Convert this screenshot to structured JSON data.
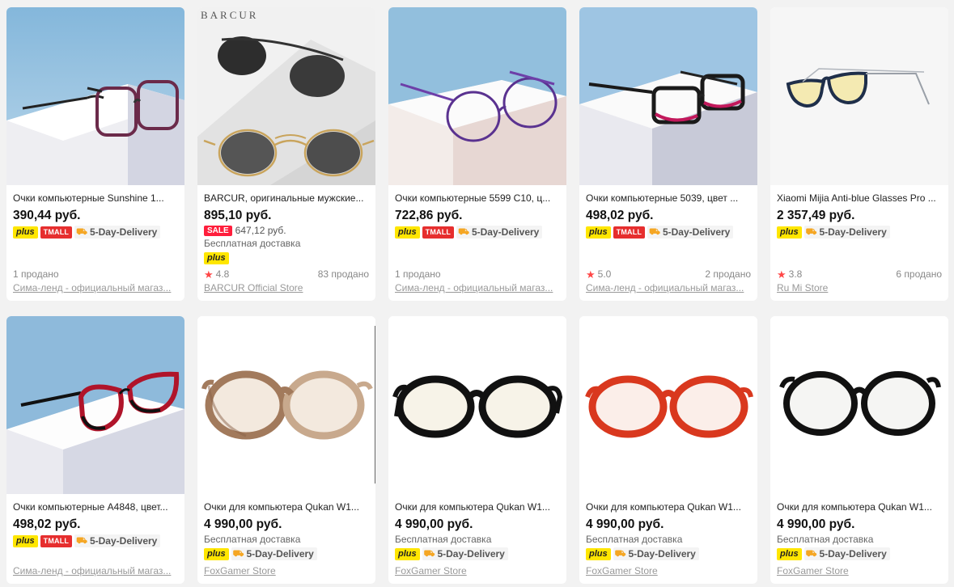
{
  "products": [
    {
      "title": "Очки компьютерные Sunshine 1...",
      "price": "390,44 руб.",
      "badges": {
        "plus": "plus",
        "tmall": "TMALL",
        "delivery": "5-Day-Delivery"
      },
      "sold": "1 продано",
      "store": "Сима-ленд - официальный магаз...",
      "image_icon": "glasses-purple-frame"
    },
    {
      "title": "BARCUR, оригинальные мужские...",
      "price": "895,10 руб.",
      "sale_badge": "SALE",
      "old_price": "647,12 руб.",
      "shipping": "Бесплатная доставка",
      "badges": {
        "plus": "plus"
      },
      "rating": "4.8",
      "sold": "83 продано",
      "store": "BARCUR Official Store",
      "brand_logo": "BARCUR",
      "image_icon": "aviator-sunglasses"
    },
    {
      "title": "Очки компьютерные 5599 С10, ц...",
      "price": "722,86 руб.",
      "badges": {
        "plus": "plus",
        "tmall": "TMALL",
        "delivery": "5-Day-Delivery"
      },
      "sold": "1 продано",
      "store": "Сима-ленд - официальный магаз...",
      "image_icon": "glasses-round-purple"
    },
    {
      "title": "Очки компьютерные 5039, цвет ...",
      "price": "498,02 руб.",
      "badges": {
        "plus": "plus",
        "tmall": "TMALL",
        "delivery": "5-Day-Delivery"
      },
      "rating": "5.0",
      "sold": "2 продано",
      "store": "Сима-ленд - официальный магаз...",
      "image_icon": "glasses-black-pink"
    },
    {
      "title": "Xiaomi Mijia Anti-blue Glasses Pro ...",
      "price": "2 357,49 руб.",
      "badges": {
        "plus": "plus",
        "delivery": "5-Day-Delivery"
      },
      "rating": "3.8",
      "sold": "6 продано",
      "store": "Ru Mi Store",
      "image_icon": "glasses-xiaomi"
    },
    {
      "title": "Очки компьютерные А4848, цвет...",
      "price": "498,02 руб.",
      "badges": {
        "plus": "plus",
        "tmall": "TMALL",
        "delivery": "5-Day-Delivery"
      },
      "store": "Сима-ленд - официальный магаз...",
      "image_icon": "glasses-cateye-red"
    },
    {
      "title": "Очки для компьютера Qukan W1...",
      "price": "4 990,00 руб.",
      "shipping": "Бесплатная доставка",
      "badges": {
        "plus": "plus",
        "delivery": "5-Day-Delivery"
      },
      "store": "FoxGamer Store",
      "image_icon": "glasses-round-brown"
    },
    {
      "title": "Очки для компьютера Qukan W1...",
      "price": "4 990,00 руб.",
      "shipping": "Бесплатная доставка",
      "badges": {
        "plus": "plus",
        "delivery": "5-Day-Delivery"
      },
      "store": "FoxGamer Store",
      "image_icon": "glasses-round-black"
    },
    {
      "title": "Очки для компьютера Qukan W1...",
      "price": "4 990,00 руб.",
      "shipping": "Бесплатная доставка",
      "badges": {
        "plus": "plus",
        "delivery": "5-Day-Delivery"
      },
      "store": "FoxGamer Store",
      "image_icon": "glasses-round-red"
    },
    {
      "title": "Очки для компьютера Qukan W1...",
      "price": "4 990,00 руб.",
      "shipping": "Бесплатная доставка",
      "badges": {
        "plus": "plus",
        "delivery": "5-Day-Delivery"
      },
      "store": "FoxGamer Store",
      "image_icon": "glasses-round-black-2"
    }
  ],
  "colors": {
    "plus_badge": "#ffe600",
    "tmall_badge": "#e62e2e",
    "sale_badge": "#ff1e3c",
    "star": "#ff4747",
    "page_bg": "#f2f2f2"
  }
}
